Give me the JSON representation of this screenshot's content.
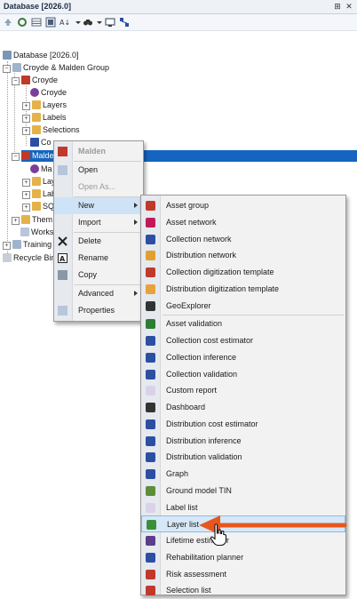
{
  "window": {
    "title": "Database [2026.0]",
    "pin_glyph": "⊞",
    "close_glyph": "✕"
  },
  "toolbar": {
    "icons": [
      "up-arrow-icon",
      "refresh-icon",
      "grid-icon",
      "sort-icon",
      "binoculars-icon",
      "screen-icon",
      "network-icon"
    ]
  },
  "tree": {
    "root": "Database [2026.0]",
    "group": "Croyde & Malden Group",
    "croyde": "Croyde",
    "croyde_network": "Croyde",
    "layers": "Layers",
    "labels": "Labels",
    "selections": "Selections",
    "co_partial": "Co",
    "malden": "Malden",
    "ma_partial": "Ma",
    "lay_partial": "Lay",
    "lab_partial": "Lab",
    "sq_partial": "SQ",
    "them_partial": "Them",
    "work_partial": "Works",
    "training_partial": "Training",
    "recycle_partial": "Recycle Bin"
  },
  "context_menu": {
    "header": "Malden",
    "open": "Open",
    "open_as": "Open As...",
    "new": "New",
    "import": "Import",
    "delete": "Delete",
    "rename": "Rename",
    "copy": "Copy",
    "advanced": "Advanced",
    "properties": "Properties"
  },
  "new_submenu": {
    "items": [
      {
        "label": "Asset group",
        "icon": "asset-group-icon",
        "color": "#c0392b"
      },
      {
        "label": "Asset network",
        "icon": "asset-network-icon",
        "color": "#c2185b"
      },
      {
        "label": "Collection network",
        "icon": "collection-network-icon",
        "color": "#2c4fa3"
      },
      {
        "label": "Distribution network",
        "icon": "distribution-network-icon",
        "color": "#e0a030"
      },
      {
        "label": "Collection digitization template",
        "icon": "collection-template-icon",
        "color": "#c0392b"
      },
      {
        "label": "Distribution digitization template",
        "icon": "distribution-template-icon",
        "color": "#e6a23c"
      },
      {
        "label": "GeoExplorer",
        "icon": "geoexplorer-icon",
        "color": "#333333"
      },
      {
        "label": "Asset validation",
        "icon": "asset-validation-icon",
        "color": "#2e7d32"
      },
      {
        "label": "Collection cost estimator",
        "icon": "collection-cost-icon",
        "color": "#2c4fa3"
      },
      {
        "label": "Collection inference",
        "icon": "collection-inference-icon",
        "color": "#2c4fa3"
      },
      {
        "label": "Collection validation",
        "icon": "collection-validation-icon",
        "color": "#2c4fa3"
      },
      {
        "label": "Custom report",
        "icon": "custom-report-icon",
        "color": "#d9d2e9"
      },
      {
        "label": "Dashboard",
        "icon": "dashboard-icon",
        "color": "#333333"
      },
      {
        "label": "Distribution cost estimator",
        "icon": "distribution-cost-icon",
        "color": "#2c4fa3"
      },
      {
        "label": "Distribution inference",
        "icon": "distribution-inference-icon",
        "color": "#2c4fa3"
      },
      {
        "label": "Distribution validation",
        "icon": "distribution-validation-icon",
        "color": "#2c4fa3"
      },
      {
        "label": "Graph",
        "icon": "graph-icon",
        "color": "#2c4fa3"
      },
      {
        "label": "Ground model TIN",
        "icon": "ground-model-icon",
        "color": "#5d8c3a"
      },
      {
        "label": "Label list",
        "icon": "label-list-icon",
        "color": "#d9d2e9"
      },
      {
        "label": "Layer list",
        "icon": "layer-list-icon",
        "color": "#3a8f3a"
      },
      {
        "label": "Lifetime estimator",
        "icon": "lifetime-icon",
        "color": "#5c3c8c"
      },
      {
        "label": "Rehabilitation planner",
        "icon": "rehab-planner-icon",
        "color": "#2c4fa3"
      },
      {
        "label": "Risk assessment",
        "icon": "risk-assessment-icon",
        "color": "#c0392b"
      },
      {
        "label": "Selection list",
        "icon": "selection-list-icon",
        "color": "#c0392b"
      }
    ]
  },
  "colors": {
    "selection": "#1565c0",
    "arrow": "#e8561e",
    "menu_bg": "#f2f2f2",
    "hover": "#cfe3f6"
  }
}
